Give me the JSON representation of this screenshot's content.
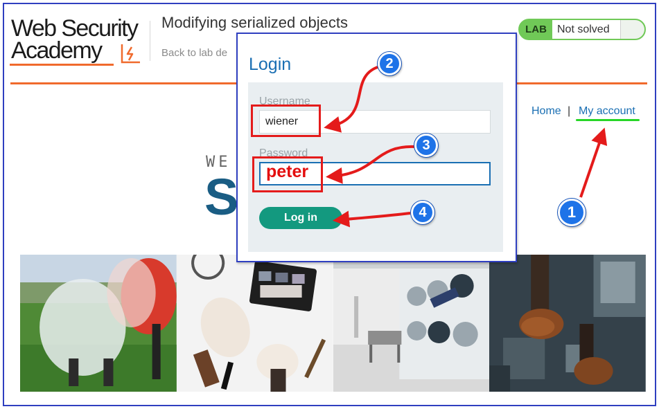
{
  "header": {
    "logo_line1": "Web Security",
    "logo_line2": "Academy",
    "lab_title": "Modifying serialized objects",
    "back_link": "Back to lab de",
    "lab_badge": "LAB",
    "lab_state": "Not solved"
  },
  "nav": {
    "home": "Home",
    "separator": "|",
    "my_account": "My account"
  },
  "hero": {
    "welcome": "WE",
    "big_letter": "S"
  },
  "modal": {
    "title": "Login",
    "username_label": "Username",
    "username_value": "wiener",
    "password_label": "Password",
    "password_value": "peter",
    "login_button": "Log in"
  },
  "steps": [
    "1",
    "2",
    "3",
    "4"
  ],
  "colors": {
    "accent_orange": "#f06a2c",
    "link_blue": "#1a6fb3",
    "lab_green": "#70c957",
    "button_teal": "#13997f",
    "annotation_red": "#e41b1b",
    "step_blue": "#1e73e8"
  }
}
